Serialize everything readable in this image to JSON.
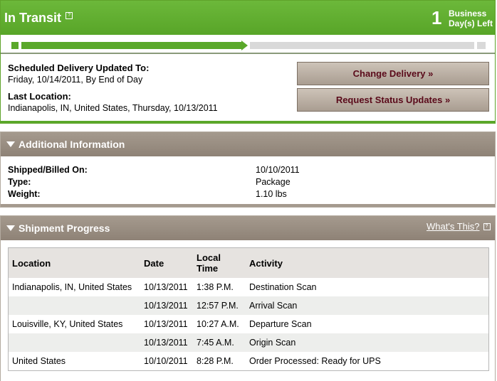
{
  "status": {
    "title": "In Transit",
    "days_left_number": "1",
    "days_left_line1": "Business",
    "days_left_line2": "Day(s) Left",
    "progress_fraction": 0.5
  },
  "delivery": {
    "scheduled_label": "Scheduled Delivery Updated To:",
    "scheduled_value": "Friday, 10/14/2011, By End of Day",
    "last_location_label": "Last Location:",
    "last_location_value": "Indianapolis, IN, United States, Thursday, 10/13/2011",
    "change_delivery_button": "Change Delivery »",
    "request_updates_button": "Request Status Updates »"
  },
  "additional_info": {
    "title": "Additional Information",
    "rows": [
      {
        "label": "Shipped/Billed On:",
        "value": "10/10/2011"
      },
      {
        "label": "Type:",
        "value": "Package"
      },
      {
        "label": "Weight:",
        "value": "1.10 lbs"
      }
    ]
  },
  "shipment_progress": {
    "title": "Shipment Progress",
    "whats_this": "What's This?",
    "columns": {
      "location": "Location",
      "date": "Date",
      "local_time_line1": "Local",
      "local_time_line2": "Time",
      "activity": "Activity"
    },
    "rows": [
      {
        "location": "Indianapolis, IN, United States",
        "date": "10/13/2011",
        "time": "1:38 P.M.",
        "activity": "Destination Scan"
      },
      {
        "location": "",
        "date": "10/13/2011",
        "time": "12:57 P.M.",
        "activity": "Arrival Scan"
      },
      {
        "location": "Louisville, KY, United States",
        "date": "10/13/2011",
        "time": "10:27 A.M.",
        "activity": "Departure Scan"
      },
      {
        "location": "",
        "date": "10/13/2011",
        "time": "7:45 A.M.",
        "activity": "Origin Scan"
      },
      {
        "location": "United States",
        "date": "10/10/2011",
        "time": "8:28 P.M.",
        "activity": "Order Processed: Ready for UPS"
      }
    ]
  },
  "colors": {
    "transit_green": "#5aa82a",
    "section_brown": "#9a8e82",
    "button_text": "#5a0a1a"
  }
}
